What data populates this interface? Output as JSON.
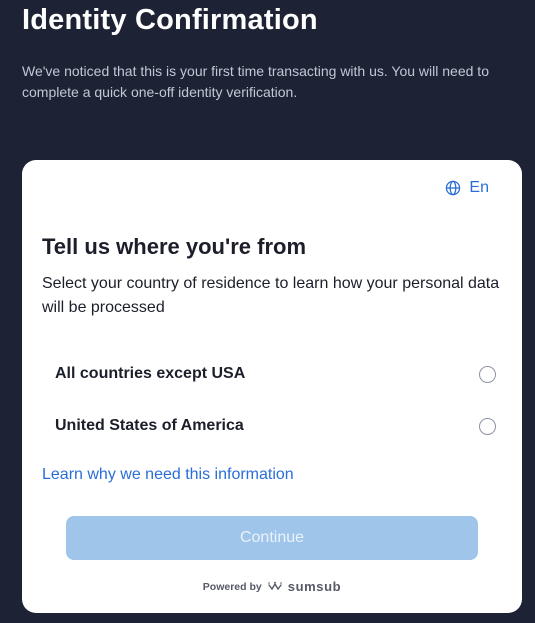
{
  "header": {
    "title": "Identity Confirmation",
    "description": "We've noticed that this is your first time transacting with us. You will need to complete a quick one-off identity verification."
  },
  "card": {
    "language": {
      "icon": "globe-icon",
      "label": "En"
    },
    "title": "Tell us where you're from",
    "description": "Select your country of residence to learn how your personal data will be processed",
    "options": [
      {
        "label": "All countries except USA",
        "selected": false
      },
      {
        "label": "United States of America",
        "selected": false
      }
    ],
    "learn_link": "Learn why we need this information",
    "continue_label": "Continue",
    "footer": {
      "powered_by": "Powered by",
      "brand": "sumsub",
      "brand_icon": "sumsub-logo-icon"
    }
  },
  "colors": {
    "background": "#1d2335",
    "link": "#2a6ed8",
    "button_disabled": "#9fc6ea"
  }
}
